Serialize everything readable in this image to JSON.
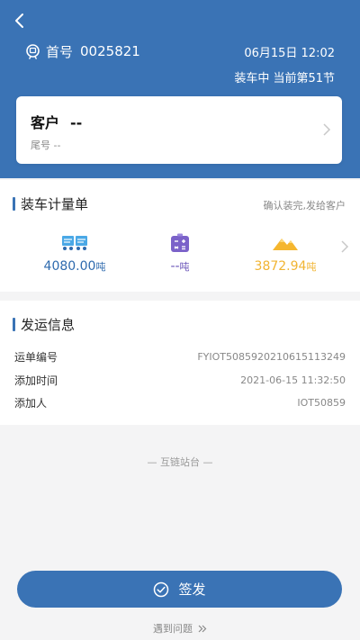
{
  "header": {
    "train_label": "首号",
    "train_number": "0025821",
    "datetime": "06月15日 12:02",
    "loading_status": "装车中 当前第51节"
  },
  "customer": {
    "label": "客户",
    "value": "--",
    "tail_label": "尾号",
    "tail_value": "--"
  },
  "loading_sheet": {
    "title": "装车计量单",
    "confirm_link": "确认装完,发给客户",
    "metrics": [
      {
        "icon": "wagon-icon",
        "value": "4080.00",
        "unit": "吨",
        "color": "#2e6aae"
      },
      {
        "icon": "calculator-icon",
        "value": "--",
        "unit": "吨",
        "color": "#6a54b8"
      },
      {
        "icon": "coal-pile-icon",
        "value": "3872.94",
        "unit": "吨",
        "color": "#f1b432"
      }
    ]
  },
  "shipment_info": {
    "title": "发运信息",
    "rows": [
      {
        "label": "运单编号",
        "value": "FYIOT5085920210615113249"
      },
      {
        "label": "添加时间",
        "value": "2021-06-15 11:32:50"
      },
      {
        "label": "添加人",
        "value": "IOT50859"
      }
    ]
  },
  "footer": {
    "brand": "— 互链站台 —"
  },
  "actions": {
    "issue_label": "签发",
    "problem_link": "遇到问题"
  },
  "colors": {
    "primary": "#3a73b5",
    "background": "#f4f4f5"
  }
}
